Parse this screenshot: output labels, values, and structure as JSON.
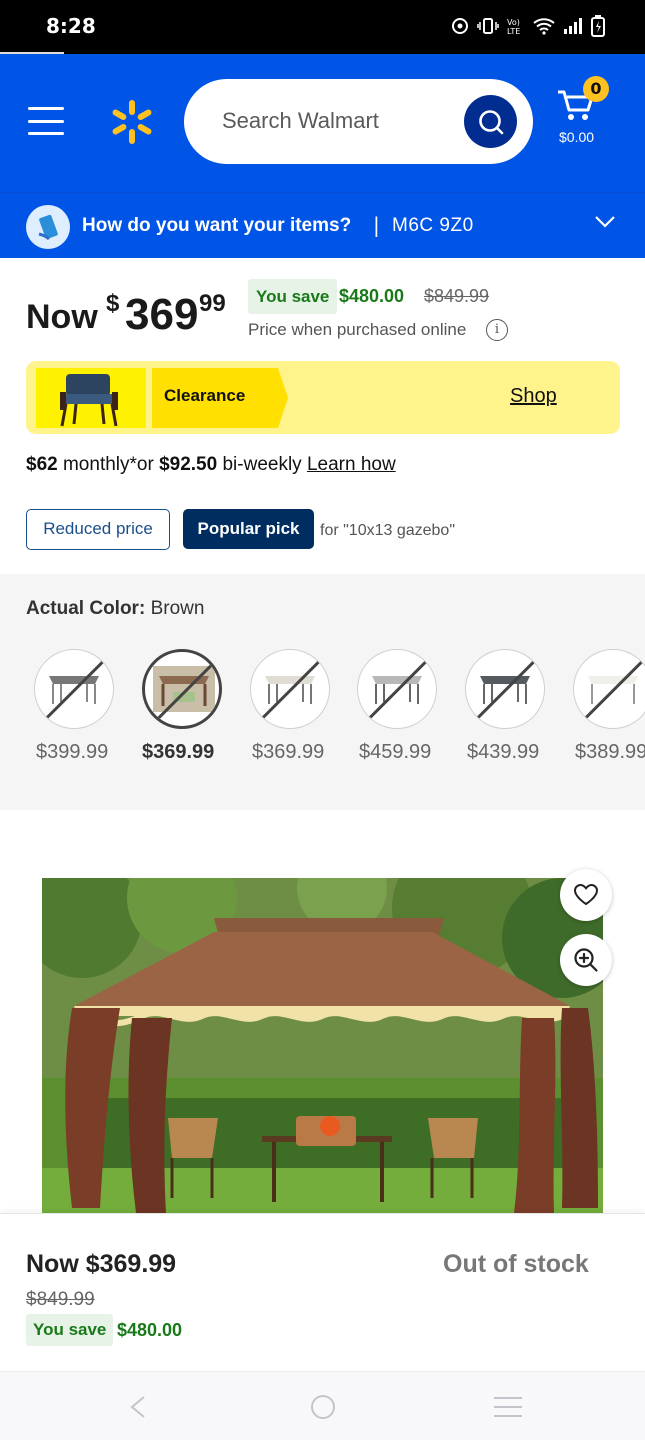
{
  "status_bar": {
    "time": "8:28",
    "icons": [
      "alarm-icon",
      "vibrate-icon",
      "volte-icon",
      "wifi-icon",
      "signal-icon",
      "battery-icon"
    ]
  },
  "header": {
    "search": {
      "placeholder": "Search Walmart",
      "value": ""
    },
    "cart": {
      "count": "0",
      "total": "$0.00"
    },
    "brand_color": "#0054e6",
    "accent_color": "#ffc220"
  },
  "delivery": {
    "question": "How do you want your items?",
    "separator": "|",
    "postal_code": "M6C 9Z0"
  },
  "price": {
    "now_label": "Now",
    "currency": "$",
    "dollars": "369",
    "cents": "99",
    "you_save_label": "You save",
    "save_amount": "$480.00",
    "was_price": "$849.99",
    "online_note": "Price when purchased online"
  },
  "clearance_banner": {
    "label": "Clearance",
    "link": "Shop"
  },
  "financing": {
    "monthly": "$62",
    "monthly_text": " monthly*or ",
    "biweekly": "$92.50",
    "biweekly_text": " bi-weekly ",
    "link": "Learn how"
  },
  "badges": {
    "reduced": "Reduced price",
    "popular": "Popular pick",
    "popular_for": "for \"10x13 gazebo\""
  },
  "color_picker": {
    "label": "Actual Color:",
    "value": "Brown",
    "options": [
      {
        "price": "$399.99",
        "selected": false
      },
      {
        "price": "$369.99",
        "selected": true
      },
      {
        "price": "$369.99",
        "selected": false
      },
      {
        "price": "$459.99",
        "selected": false
      },
      {
        "price": "$439.99",
        "selected": false
      },
      {
        "price": "$389.99",
        "selected": false
      }
    ]
  },
  "sticky_bar": {
    "now": "Now $369.99",
    "was": "$849.99",
    "you_save_label": "You save",
    "save_amount": "$480.00",
    "status": "Out of stock"
  },
  "nav_bar": {
    "buttons": [
      "back-icon",
      "home-icon",
      "recents-icon"
    ]
  }
}
